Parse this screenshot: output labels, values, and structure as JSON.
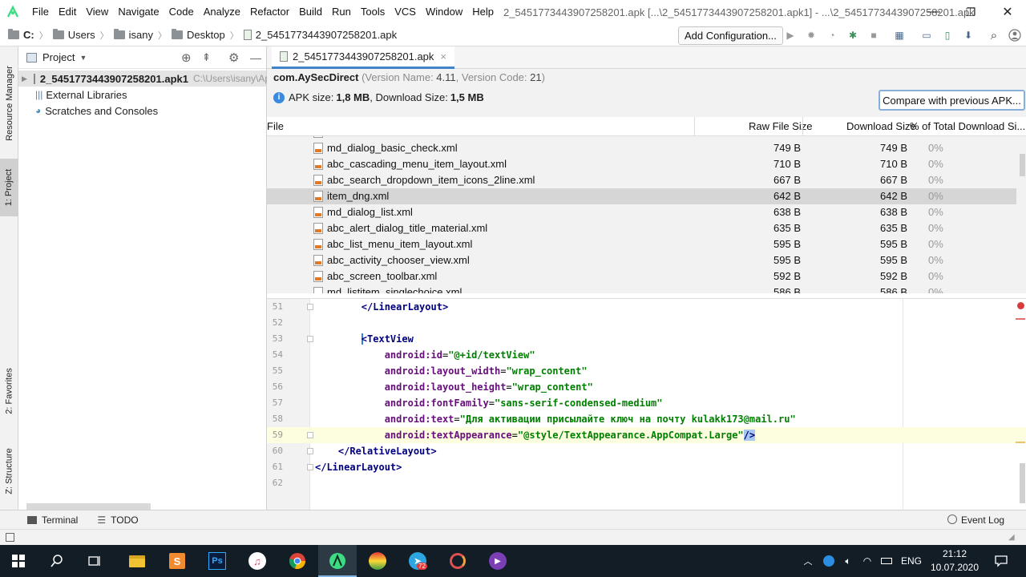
{
  "window": {
    "title": "2_5451773443907258201.apk [...\\2_5451773443907258201.apk1] - ...\\2_5451773443907258201.apk",
    "minimize": "—",
    "restore": "❐",
    "close": "✕"
  },
  "menu": [
    "File",
    "Edit",
    "View",
    "Navigate",
    "Code",
    "Analyze",
    "Refactor",
    "Build",
    "Run",
    "Tools",
    "VCS",
    "Window",
    "Help"
  ],
  "breadcrumb": [
    "C:",
    "Users",
    "isany",
    "Desktop",
    "2_5451773443907258201.apk"
  ],
  "toolbar": {
    "add_configuration": "Add Configuration..."
  },
  "side_tabs": {
    "resource_manager": "Resource Manager",
    "project": "1: Project",
    "favorites": "2: Favorites",
    "structure": "Z: Structure"
  },
  "project_panel": {
    "title": "Project",
    "tree": [
      {
        "label": "2_5451773443907258201.apk1",
        "path": "C:\\Users\\isany\\Ap"
      },
      {
        "label": "External Libraries"
      },
      {
        "label": "Scratches and Consoles"
      }
    ]
  },
  "editor_tab": {
    "label": "2_5451773443907258201.apk",
    "close": "×"
  },
  "apk": {
    "package": "com.AySecDirect",
    "version_prefix": "(Version Name: ",
    "version_name": "4.11",
    "version_code_prefix": ", Version Code: ",
    "version_code": "21",
    "version_suffix": ")",
    "size_prefix": "APK size: ",
    "apk_size": "1,8 MB",
    "download_prefix": ", Download Size: ",
    "download_size": "1,5 MB",
    "compare_button": "Compare with previous APK..."
  },
  "table": {
    "columns": [
      "File",
      "Raw File Size",
      "Download Size",
      "% of Total Download Si..."
    ],
    "rows": [
      {
        "name": "md_dialog_basic_check.xml",
        "raw": "749 B",
        "download": "749 B",
        "pct": "0%"
      },
      {
        "name": "abc_cascading_menu_item_layout.xml",
        "raw": "710 B",
        "download": "710 B",
        "pct": "0%"
      },
      {
        "name": "abc_search_dropdown_item_icons_2line.xml",
        "raw": "667 B",
        "download": "667 B",
        "pct": "0%"
      },
      {
        "name": "item_dng.xml",
        "raw": "642 B",
        "download": "642 B",
        "pct": "0%"
      },
      {
        "name": "md_dialog_list.xml",
        "raw": "638 B",
        "download": "638 B",
        "pct": "0%"
      },
      {
        "name": "abc_alert_dialog_title_material.xml",
        "raw": "635 B",
        "download": "635 B",
        "pct": "0%"
      },
      {
        "name": "abc_list_menu_item_layout.xml",
        "raw": "595 B",
        "download": "595 B",
        "pct": "0%"
      },
      {
        "name": "abc_activity_chooser_view.xml",
        "raw": "595 B",
        "download": "595 B",
        "pct": "0%"
      },
      {
        "name": "abc_screen_toolbar.xml",
        "raw": "592 B",
        "download": "592 B",
        "pct": "0%"
      },
      {
        "name": "md_listitem_singlechoice.xml",
        "raw": "586 B",
        "download": "586 B",
        "pct": "0%"
      }
    ],
    "selected_row": "item_dng.xml"
  },
  "code": {
    "lines": [
      {
        "no": "51",
        "indent": "        ",
        "tokens": [
          [
            "tag",
            "</LinearLayout"
          ],
          [
            "tag",
            ">"
          ]
        ]
      },
      {
        "no": "52",
        "indent": "",
        "tokens": []
      },
      {
        "no": "53",
        "indent": "        ",
        "tokens": [
          [
            "tag",
            "<TextView"
          ]
        ]
      },
      {
        "no": "54",
        "indent": "            ",
        "tokens": [
          [
            "attr",
            "android:id"
          ],
          [
            "punct",
            "="
          ],
          [
            "val",
            "\"@+id/textView\""
          ]
        ]
      },
      {
        "no": "55",
        "indent": "            ",
        "tokens": [
          [
            "attr",
            "android:layout_width"
          ],
          [
            "punct",
            "="
          ],
          [
            "val",
            "\"wrap_content\""
          ]
        ]
      },
      {
        "no": "56",
        "indent": "            ",
        "tokens": [
          [
            "attr",
            "android:layout_height"
          ],
          [
            "punct",
            "="
          ],
          [
            "val",
            "\"wrap_content\""
          ]
        ]
      },
      {
        "no": "57",
        "indent": "            ",
        "tokens": [
          [
            "attr",
            "android:fontFamily"
          ],
          [
            "punct",
            "="
          ],
          [
            "val",
            "\"sans-serif-condensed-medium\""
          ]
        ]
      },
      {
        "no": "58",
        "indent": "            ",
        "tokens": [
          [
            "attr",
            "android:text"
          ],
          [
            "punct",
            "="
          ],
          [
            "val",
            "\"Для активации присылайте ключ на почту kulakk173@mail.ru\""
          ]
        ]
      },
      {
        "no": "59",
        "indent": "            ",
        "tokens": [
          [
            "attr",
            "android:textAppearance"
          ],
          [
            "punct",
            "="
          ],
          [
            "val",
            "\"@style/TextAppearance.AppCompat.Large\""
          ],
          [
            "tag",
            "/>"
          ]
        ]
      },
      {
        "no": "60",
        "indent": "    ",
        "tokens": [
          [
            "tag",
            "</RelativeLayout"
          ],
          [
            "tag",
            ">"
          ]
        ]
      },
      {
        "no": "61",
        "indent": "",
        "tokens": [
          [
            "tag",
            "</LinearLayout"
          ],
          [
            "tag",
            ">"
          ]
        ]
      },
      {
        "no": "62",
        "indent": "",
        "tokens": []
      }
    ]
  },
  "bottom_tools": {
    "terminal": "Terminal",
    "todo": "TODO",
    "event_log": "Event Log"
  },
  "taskbar": {
    "language": "ENG",
    "time": "21:12",
    "date": "10.07.2020",
    "telegram_badge": "72"
  },
  "colors": {
    "accent": "#4083c9",
    "android_green": "#3ddc84",
    "xml_tag": "#000080",
    "xml_attr": "#660e7a",
    "xml_value": "#008000",
    "taskbar": "#121d26"
  }
}
